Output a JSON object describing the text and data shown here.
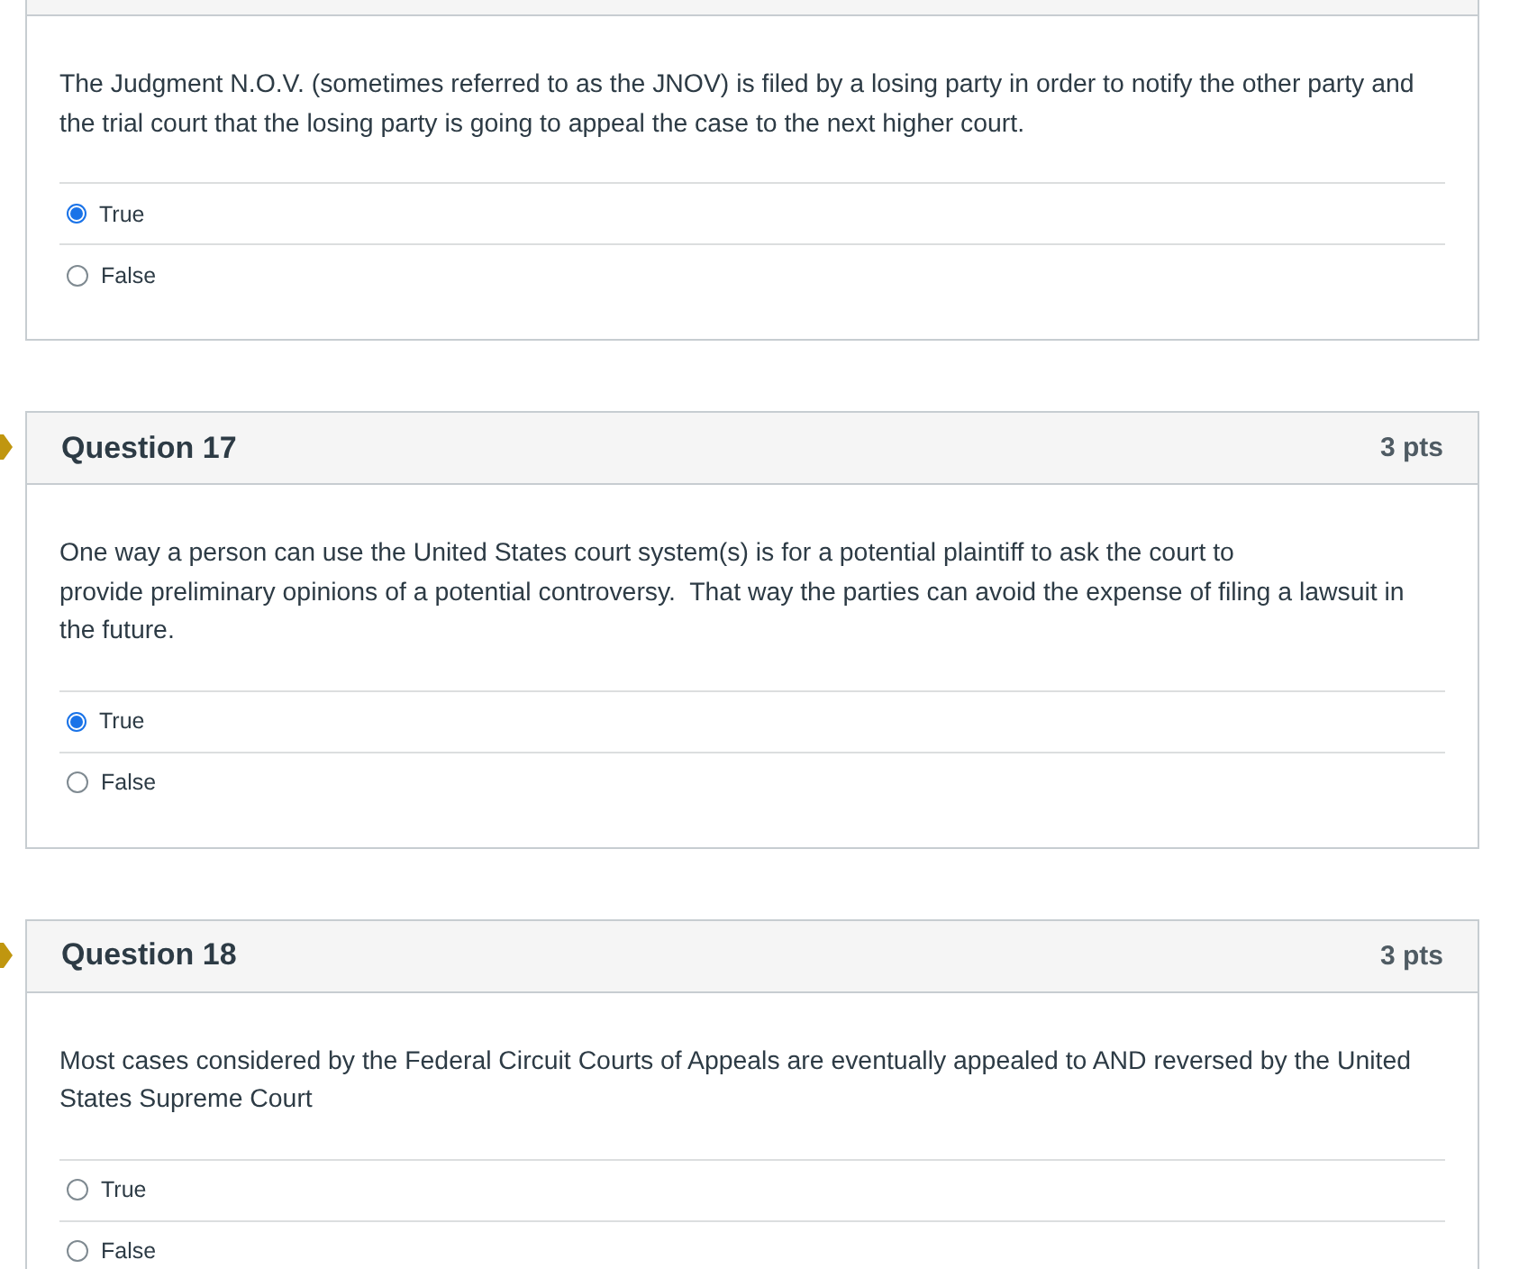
{
  "questions": [
    {
      "text": "The Judgment N.O.V. (sometimes referred to as the JNOV) is filed by a losing party in order to notify the other party and the trial court that the losing party is going to appeal the case to the next higher court.",
      "options": [
        {
          "label": "True",
          "selected": true
        },
        {
          "label": "False",
          "selected": false
        }
      ]
    },
    {
      "marked": true,
      "title": "Question 17",
      "points": "3 pts",
      "text": "One way a person can use the United States court system(s) is for a potential plaintiff to ask the court to\nprovide preliminary opinions of a potential controversy.  That way the parties can avoid the expense of filing a lawsuit in the future.",
      "options": [
        {
          "label": "True",
          "selected": true
        },
        {
          "label": "False",
          "selected": false
        }
      ]
    },
    {
      "marked": true,
      "title": "Question 18",
      "points": "3 pts",
      "text": "Most cases considered by the Federal Circuit Courts of Appeals are eventually appealed to AND reversed by the United States Supreme Court",
      "options": [
        {
          "label": "True",
          "selected": false
        },
        {
          "label": "False",
          "selected": false
        }
      ]
    }
  ]
}
